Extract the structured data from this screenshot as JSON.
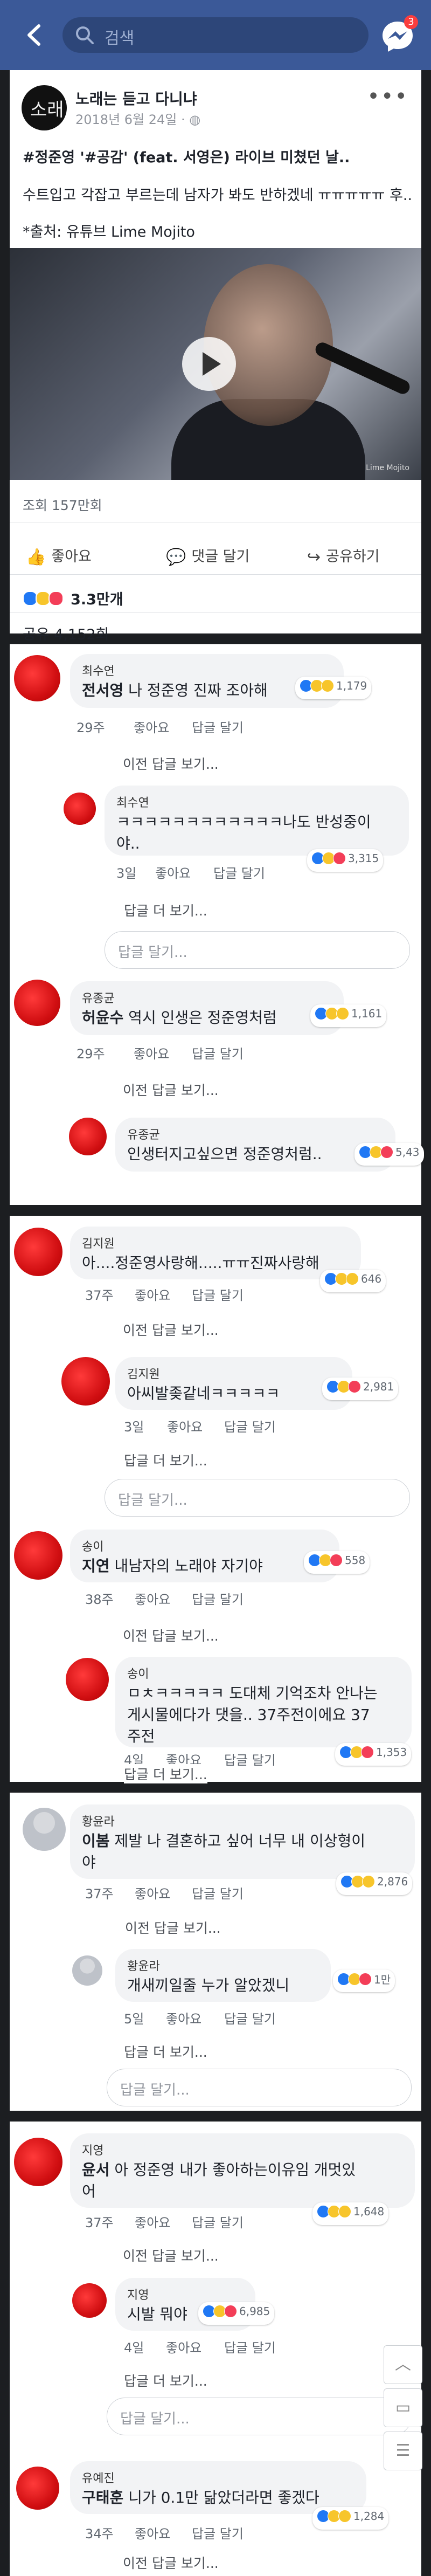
{
  "header": {
    "search_placeholder": "검색",
    "badge": "3"
  },
  "post": {
    "page_name": "노래는 듣고 다니냐",
    "logo_text": "소래",
    "date": "2018년 6월 24일 · ",
    "text_line1": "#정준영 '#공감' (feat. 서영은) 라이브 미쳤던 날..",
    "text_line2": "수트입고 각잡고 부르는데 남자가 봐도 반하겠네 ㅠㅠㅠㅠㅠ 후..",
    "text_line3": "*출처: 유튜브 Lime Mojito",
    "video_watermark": "Lime Mojito",
    "views": "조회 157만회",
    "like_label": "좋아요",
    "comment_label": "댓글 달기",
    "share_label": "공유하기",
    "reactions_count": "3.3만개",
    "shares": "공유 4,152회"
  },
  "labels": {
    "like": "좋아요",
    "reply": "답글 달기",
    "prev_replies": "이전 답글 보기...",
    "more_replies": "답글 더 보기...",
    "reply_placeholder": "답글 달기..."
  },
  "threads": [
    {
      "c1": {
        "name": "최수연",
        "tag": "전서영",
        "text": " 나 정준영 진짜 조아해",
        "time": "29주",
        "count": "1,179"
      },
      "c2": {
        "name": "최수연",
        "text1": "ㅋㅋㅋㅋㅋㅋㅋㅋㅋㅋㅋㅋ나도 반성중이",
        "text2": "야..",
        "time": "3일",
        "count": "3,315"
      },
      "c3": {
        "name": "유종균",
        "tag": "허윤수",
        "text": " 역시 인생은 정준영처럼",
        "time": "29주",
        "count": "1,161"
      },
      "c4": {
        "name": "유종균",
        "text": "인생터지고싶으면 정준영처럼..",
        "count": "5,43"
      }
    },
    {
      "c1": {
        "name": "김지원",
        "text": "아....정준영사랑해.....ㅠㅠ진짜사랑해",
        "time": "37주",
        "count": "646"
      },
      "c2": {
        "name": "김지원",
        "text": "아씨발좆같네ㅋㅋㅋㅋㅋ",
        "time": "3일",
        "count": "2,981"
      },
      "c3": {
        "name": "송이",
        "tag": "지연",
        "text": " 내남자의 노래야 자기야",
        "time": "38주",
        "count": "558"
      },
      "c4": {
        "name": "송이",
        "text1": "ㅁㅊㅋㅋㅋㅋㅋ 도대체 기억조차 안나는",
        "text2": "게시물에다가 댓을.. 37주전이에요 37",
        "text3": "주전",
        "time": "4일",
        "count": "1,353"
      }
    },
    {
      "c1": {
        "name": "황윤라",
        "tag": "이봄",
        "text1": " 제발 나 결혼하고 싶어 너무 내 이상형이",
        "text2": "야",
        "time": "37주",
        "count": "2,876"
      },
      "c2": {
        "name": "황윤라",
        "text": "개새끼일줄 누가 알았겠니",
        "time": "5일",
        "count": "1만"
      }
    },
    {
      "c1": {
        "name": "지영",
        "tag": "윤서",
        "text1": " 아 정준영 내가 좋아하는이유임 개멋있",
        "text2": "어",
        "time": "37주",
        "count": "1,648"
      },
      "c2": {
        "name": "지영",
        "text": "시발 뭐야",
        "time": "4일",
        "count": "6,985"
      },
      "c3": {
        "name": "유예진",
        "tag": "구태훈",
        "text": " 니가 0.1만 닮았더라면 좋겠다",
        "time": "34주",
        "count": "1,284"
      }
    }
  ]
}
